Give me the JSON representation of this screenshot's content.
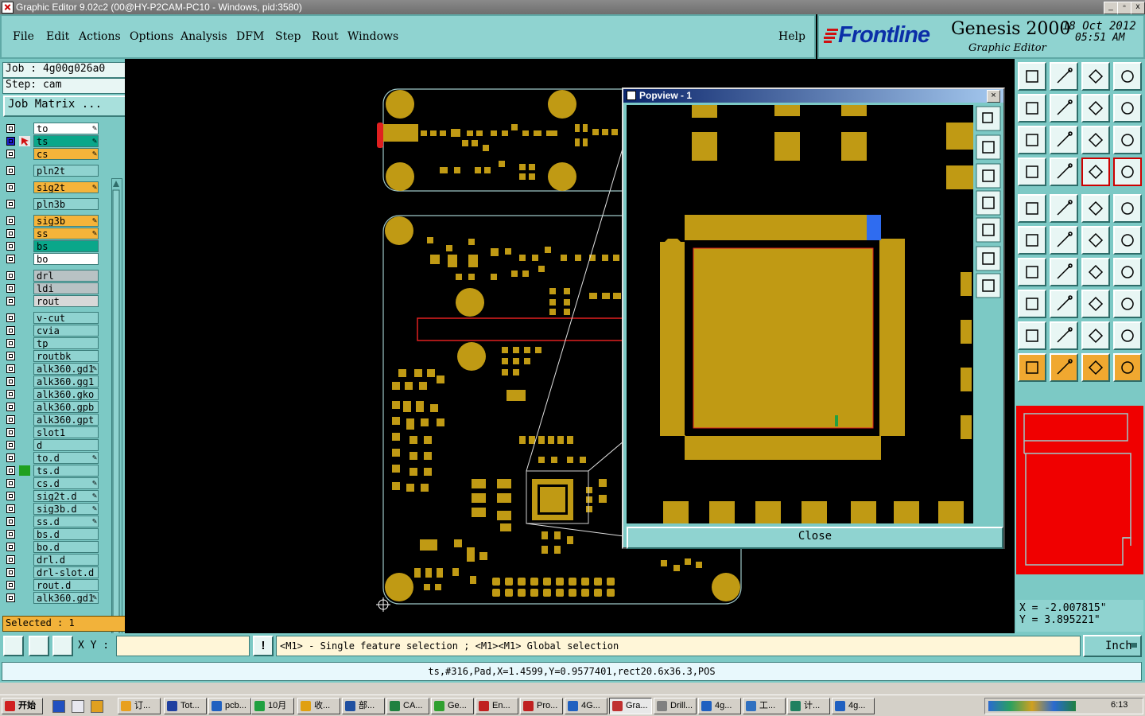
{
  "window": {
    "title": "Graphic Editor 9.02c2 (00@HY-P2CAM-PC10 - Windows, pid:3580)",
    "buttons": [
      "_",
      "▫",
      "x"
    ]
  },
  "menu": [
    "File",
    "Edit",
    "Actions",
    "Options",
    "Analysis",
    "DFM",
    "Step",
    "Rout",
    "Windows"
  ],
  "help_label": "Help",
  "brand": {
    "logo": "Frontline",
    "product": "Genesis 2000",
    "subtitle": "Graphic Editor",
    "date": "18 Oct 2012",
    "time": "05:51 AM"
  },
  "job": {
    "job_label": "Job : 4g00g026a0",
    "step_label": "Step: cam",
    "matrix_button": "Job Matrix ..."
  },
  "layers": [
    {
      "name": "to",
      "color": "#ffffff",
      "mark": "",
      "edit": true
    },
    {
      "name": "ts",
      "color": "#0aa78a",
      "mark": "work",
      "edit": true
    },
    {
      "name": "cs",
      "color": "#f5b43a",
      "mark": "",
      "edit": true
    },
    {
      "name": "pln2t",
      "color": "#8fd3d0",
      "mark": "",
      "edit": false
    },
    {
      "name": "sig2t",
      "color": "#f5b43a",
      "mark": "",
      "edit": true
    },
    {
      "name": "pln3b",
      "color": "#8fd3d0",
      "mark": "",
      "edit": false
    },
    {
      "name": "sig3b",
      "color": "#f5b43a",
      "mark": "",
      "edit": true
    },
    {
      "name": "ss",
      "color": "#f5b43a",
      "mark": "",
      "edit": true
    },
    {
      "name": "bs",
      "color": "#0aa78a",
      "mark": "",
      "edit": false
    },
    {
      "name": "bo",
      "color": "#ffffff",
      "mark": "",
      "edit": false
    },
    {
      "name": "drl",
      "color": "#b8c2c4",
      "mark": "",
      "edit": false
    },
    {
      "name": "ldi",
      "color": "#b8c2c4",
      "mark": "",
      "edit": false
    },
    {
      "name": "rout",
      "color": "#d8d8d8",
      "mark": "",
      "edit": false
    },
    {
      "name": "v-cut",
      "color": "#8fd3d0",
      "mark": "",
      "edit": false
    },
    {
      "name": "cvia",
      "color": "#8fd3d0",
      "mark": "",
      "edit": false
    },
    {
      "name": "tp",
      "color": "#8fd3d0",
      "mark": "",
      "edit": false
    },
    {
      "name": "routbk",
      "color": "#8fd3d0",
      "mark": "",
      "edit": false
    },
    {
      "name": "alk360.gd1",
      "color": "#8fd3d0",
      "mark": "",
      "edit": true
    },
    {
      "name": "alk360.gg1",
      "color": "#8fd3d0",
      "mark": "",
      "edit": false
    },
    {
      "name": "alk360.gko",
      "color": "#8fd3d0",
      "mark": "",
      "edit": false
    },
    {
      "name": "alk360.gpb",
      "color": "#8fd3d0",
      "mark": "",
      "edit": false
    },
    {
      "name": "alk360.gpt",
      "color": "#8fd3d0",
      "mark": "",
      "edit": false
    },
    {
      "name": "slot1",
      "color": "#8fd3d0",
      "mark": "",
      "edit": false
    },
    {
      "name": "d",
      "color": "#8fd3d0",
      "mark": "",
      "edit": false
    },
    {
      "name": "to.d",
      "color": "#8fd3d0",
      "mark": "",
      "edit": true
    },
    {
      "name": "ts.d",
      "color": "#8fd3d0",
      "mark": "green",
      "edit": false
    },
    {
      "name": "cs.d",
      "color": "#8fd3d0",
      "mark": "",
      "edit": true
    },
    {
      "name": "sig2t.d",
      "color": "#8fd3d0",
      "mark": "",
      "edit": true
    },
    {
      "name": "sig3b.d",
      "color": "#8fd3d0",
      "mark": "",
      "edit": true
    },
    {
      "name": "ss.d",
      "color": "#8fd3d0",
      "mark": "",
      "edit": true
    },
    {
      "name": "bs.d",
      "color": "#8fd3d0",
      "mark": "",
      "edit": false
    },
    {
      "name": "bo.d",
      "color": "#8fd3d0",
      "mark": "",
      "edit": false
    },
    {
      "name": "drl.d",
      "color": "#8fd3d0",
      "mark": "",
      "edit": false
    },
    {
      "name": "drl-slot.d",
      "color": "#8fd3d0",
      "mark": "",
      "edit": false
    },
    {
      "name": "rout.d",
      "color": "#8fd3d0",
      "mark": "",
      "edit": false
    },
    {
      "name": "alk360.gd1",
      "color": "#8fd3d0",
      "mark": "",
      "edit": true
    }
  ],
  "selected_label": "Selected : 1",
  "popview": {
    "title": "Popview - 1",
    "close_label": "Close"
  },
  "coords": {
    "x": "X = -2.007815\"",
    "y": "Y = 3.895221\""
  },
  "cmd": {
    "xy_label": "X Y :",
    "xy_value": "",
    "prompt": "<M1> - Single feature selection ; <M1><M1> Global selection",
    "units": "Inch"
  },
  "status_line": "ts,#316,Pad,X=1.4599,Y=0.9577401,rect20.6x36.3,POS",
  "taskbar": {
    "start": "开始",
    "tasks": [
      "订...",
      "Tot...",
      "pcb...",
      "10月",
      "收...",
      "部...",
      "CA...",
      "Ge...",
      "En...",
      "Pro...",
      "4G...",
      "Gra...",
      "Drill...",
      "4g...",
      "工...",
      "计...",
      "4g..."
    ],
    "clock": "6:13"
  },
  "colors": {
    "pad": "#c09a14",
    "outline": "#9ec8c8",
    "highlight_red": "#e02020",
    "panel": "#7cc9c5"
  }
}
